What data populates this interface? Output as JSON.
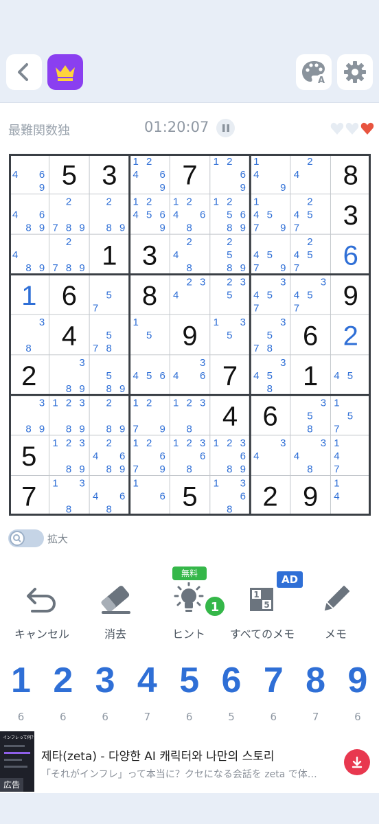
{
  "header": {
    "back_icon": "back-arrow-icon",
    "premium_icon": "crown-icon",
    "theme_icon": "palette-icon",
    "settings_icon": "gear-icon"
  },
  "status": {
    "level": "最難関数独",
    "timer": "01:20:07",
    "pause_icon": "pause-icon",
    "lives_remaining": 1,
    "lives_total": 3
  },
  "board": {
    "values": [
      [
        0,
        5,
        3,
        0,
        7,
        0,
        0,
        0,
        8
      ],
      [
        0,
        0,
        0,
        0,
        0,
        0,
        0,
        0,
        3
      ],
      [
        0,
        0,
        1,
        3,
        0,
        0,
        0,
        0,
        6
      ],
      [
        1,
        6,
        0,
        8,
        0,
        0,
        0,
        0,
        9
      ],
      [
        0,
        4,
        0,
        0,
        9,
        0,
        0,
        6,
        2
      ],
      [
        2,
        0,
        0,
        0,
        0,
        7,
        0,
        1,
        0
      ],
      [
        0,
        0,
        0,
        0,
        0,
        4,
        6,
        0,
        0
      ],
      [
        5,
        0,
        0,
        0,
        0,
        0,
        0,
        0,
        0
      ],
      [
        7,
        0,
        0,
        0,
        5,
        0,
        2,
        9,
        0
      ]
    ],
    "user_filled": [
      [
        2,
        8
      ],
      [
        3,
        0
      ],
      [
        4,
        8
      ]
    ],
    "notes": [
      [
        [
          4,
          6,
          9
        ],
        [],
        [],
        [
          1,
          2,
          4,
          6,
          9
        ],
        [],
        [
          1,
          2,
          6,
          9
        ],
        [
          1,
          4,
          9
        ],
        [
          2,
          4
        ],
        []
      ],
      [
        [
          4,
          6,
          8,
          9
        ],
        [
          2,
          7,
          8,
          9
        ],
        [
          2,
          8,
          9
        ],
        [
          1,
          2,
          4,
          5,
          6,
          9
        ],
        [
          1,
          2,
          4,
          6,
          8
        ],
        [
          1,
          2,
          5,
          6,
          8,
          9
        ],
        [
          1,
          4,
          5,
          7,
          9
        ],
        [
          2,
          4,
          5,
          7
        ],
        []
      ],
      [
        [
          4,
          8,
          9
        ],
        [
          2,
          7,
          8,
          9
        ],
        [],
        [],
        [
          2,
          4,
          8
        ],
        [
          2,
          5,
          8,
          9
        ],
        [
          4,
          5,
          7,
          9
        ],
        [
          2,
          4,
          5,
          7
        ],
        []
      ],
      [
        [],
        [],
        [
          5,
          7
        ],
        [],
        [
          2,
          3,
          4
        ],
        [
          2,
          3,
          5
        ],
        [
          3,
          4,
          5,
          7
        ],
        [
          3,
          4,
          5,
          7
        ],
        []
      ],
      [
        [
          3,
          8
        ],
        [],
        [
          5,
          7,
          8
        ],
        [
          1,
          5
        ],
        [],
        [
          1,
          3,
          5
        ],
        [
          3,
          5,
          7,
          8
        ],
        [],
        []
      ],
      [
        [],
        [
          3,
          8,
          9
        ],
        [
          5,
          8,
          9
        ],
        [
          4,
          5,
          6
        ],
        [
          3,
          4,
          6
        ],
        [],
        [
          3,
          4,
          5,
          8
        ],
        [],
        [
          4,
          5
        ]
      ],
      [
        [
          3,
          8,
          9
        ],
        [
          1,
          2,
          3,
          8,
          9
        ],
        [
          2,
          8,
          9
        ],
        [
          1,
          2,
          7,
          9
        ],
        [
          1,
          2,
          3,
          8
        ],
        [],
        [],
        [
          3,
          5,
          8
        ],
        [
          1,
          5,
          7
        ]
      ],
      [
        [],
        [
          1,
          2,
          3,
          8,
          9
        ],
        [
          2,
          4,
          6,
          8,
          9
        ],
        [
          1,
          2,
          6,
          7,
          9
        ],
        [
          1,
          2,
          3,
          6,
          8
        ],
        [
          1,
          2,
          3,
          6,
          8,
          9
        ],
        [
          3,
          4
        ],
        [
          3,
          4,
          8
        ],
        [
          1,
          4,
          7
        ]
      ],
      [
        [],
        [
          1,
          3,
          8
        ],
        [
          4,
          6,
          8
        ],
        [
          1,
          6
        ],
        [],
        [
          1,
          3,
          6,
          8
        ],
        [],
        [],
        [
          1,
          4
        ]
      ]
    ],
    "colors": {
      "given": "#111111",
      "user": "#2f6fd6",
      "note": "#2f6fd6",
      "thin_line": "#c3c7cc",
      "thick_line": "#3a3f45"
    }
  },
  "zoom": {
    "label": "拡大",
    "icon": "magnifier-icon",
    "enabled": false
  },
  "tools": [
    {
      "label": "キャンセル",
      "icon": "undo-icon"
    },
    {
      "label": "消去",
      "icon": "eraser-icon"
    },
    {
      "label": "ヒント",
      "icon": "lightbulb-icon",
      "badge_free": "無料",
      "badge_count": "1"
    },
    {
      "label": "すべてのメモ",
      "icon": "all-notes-icon",
      "badge_ad": "AD"
    },
    {
      "label": "メモ",
      "icon": "pencil-icon"
    }
  ],
  "numpad": [
    {
      "digit": "1",
      "remaining": "6"
    },
    {
      "digit": "2",
      "remaining": "6"
    },
    {
      "digit": "3",
      "remaining": "6"
    },
    {
      "digit": "4",
      "remaining": "7"
    },
    {
      "digit": "5",
      "remaining": "6"
    },
    {
      "digit": "6",
      "remaining": "5"
    },
    {
      "digit": "7",
      "remaining": "6"
    },
    {
      "digit": "8",
      "remaining": "7"
    },
    {
      "digit": "9",
      "remaining": "6"
    }
  ],
  "ad": {
    "tag": "広告",
    "thumb_caption": "インフレって何？",
    "title": "제타(zeta) - 다양한 AI 캐릭터와 나만의 스토리",
    "subtitle": "「それがインフレ」って本当に？クセになる会話を zeta で体…",
    "download_icon": "download-icon",
    "accent": "#e8384f"
  }
}
